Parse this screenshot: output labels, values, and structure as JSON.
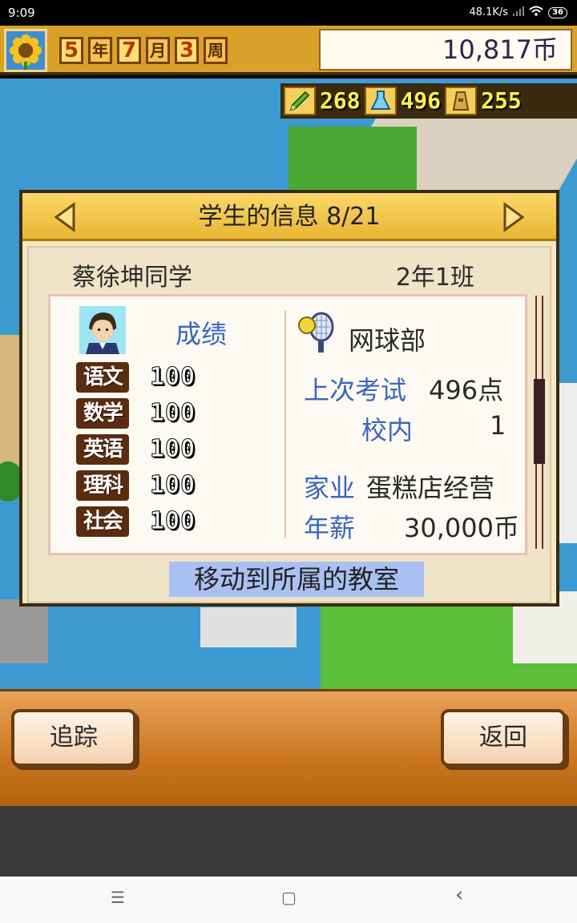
{
  "status_bar": {
    "time": "9:09",
    "net_speed": "48.1K/s",
    "battery": "36"
  },
  "hud": {
    "year": "5",
    "year_unit": "年",
    "month": "7",
    "month_unit": "月",
    "week": "3",
    "week_unit": "周",
    "money": "10,817币",
    "portrait_icon": "sunflower-icon"
  },
  "resources": {
    "research": "268",
    "science": "496",
    "tower": "255"
  },
  "dialog": {
    "title": "学生的信息 8/21",
    "student_name": "蔡徐坤同学",
    "student_class": "2年1班",
    "grades_title": "成绩",
    "grades": [
      {
        "subject": "语文",
        "score": "100"
      },
      {
        "subject": "数学",
        "score": "100"
      },
      {
        "subject": "英语",
        "score": "100"
      },
      {
        "subject": "理科",
        "score": "100"
      },
      {
        "subject": "社会",
        "score": "100"
      }
    ],
    "club": "网球部",
    "last_exam_label": "上次考试",
    "last_exam_value": "496点",
    "school_rank_label": "校内",
    "school_rank_value": "1",
    "family_label": "家业",
    "family_value": "蛋糕店经营",
    "salary_label": "年薪",
    "salary_value": "30,000币",
    "move_button": "移动到所属的教室"
  },
  "bottom": {
    "track_button": "追踪",
    "back_button": "返回"
  },
  "nav": {
    "menu": "☰",
    "home": "▢",
    "back": "‹"
  }
}
